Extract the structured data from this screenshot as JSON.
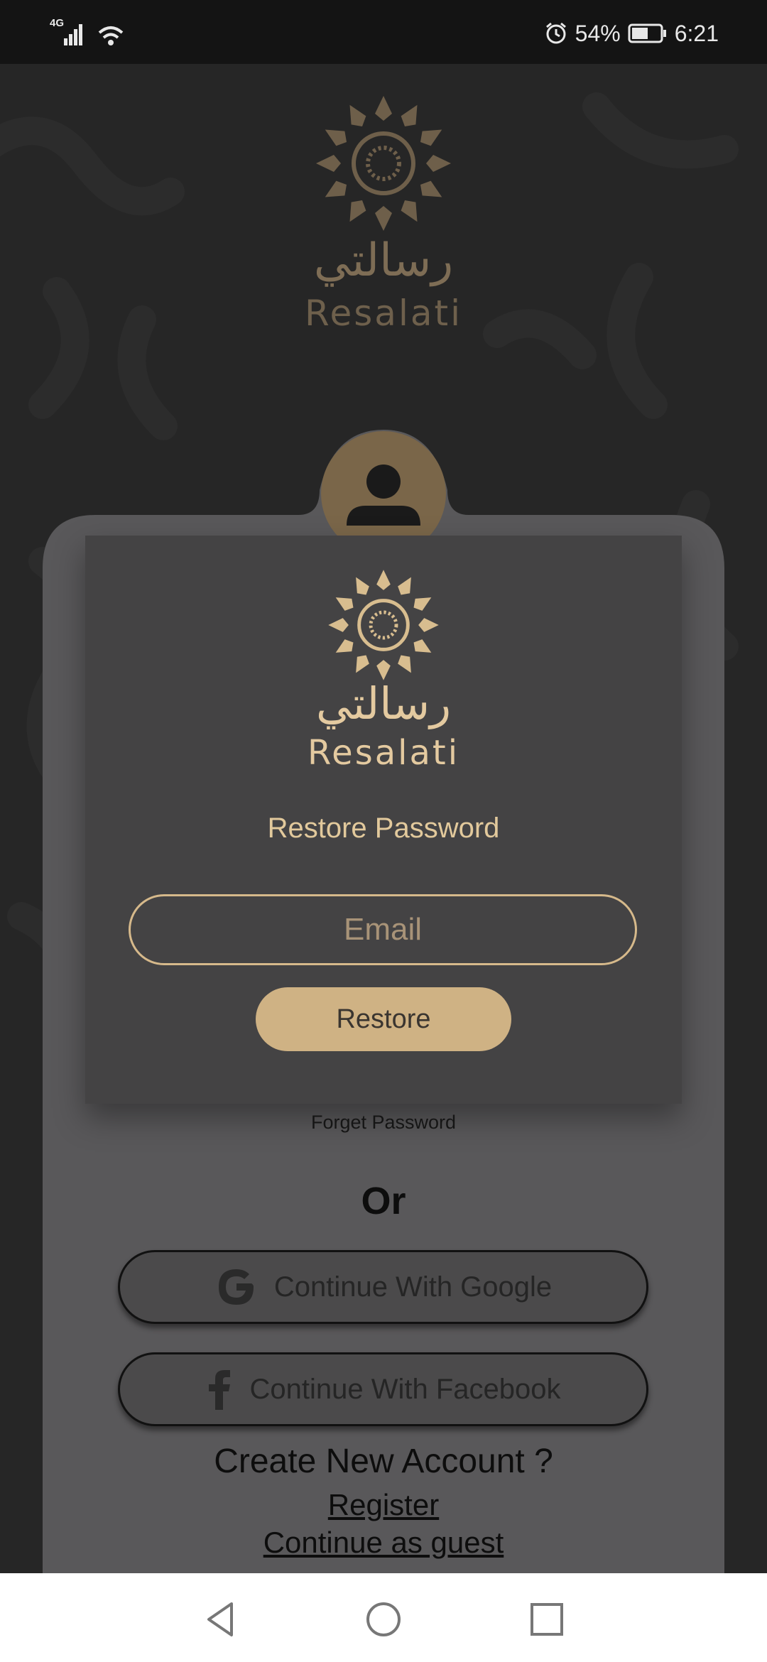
{
  "status_bar": {
    "network": "4G",
    "battery": "54%",
    "time": "6:21",
    "icons": [
      "signal-icon",
      "wifi-icon",
      "alarm-icon",
      "battery-icon"
    ]
  },
  "brand": {
    "arabic_name": "رسالتي",
    "latin_name": "Resalati"
  },
  "restore": {
    "title": "Restore Password",
    "email_placeholder": "Email",
    "button_label": "Restore"
  },
  "links": {
    "forget_password": "Forget Password",
    "or": "Or",
    "google": "Continue With Google",
    "facebook": "Continue With Facebook",
    "create_account": "Create New Account ?",
    "register": "Register",
    "guest": "Continue as guest"
  },
  "colors": {
    "accent_gold": "#cfb284",
    "card": "#444344",
    "background": "#232323"
  }
}
